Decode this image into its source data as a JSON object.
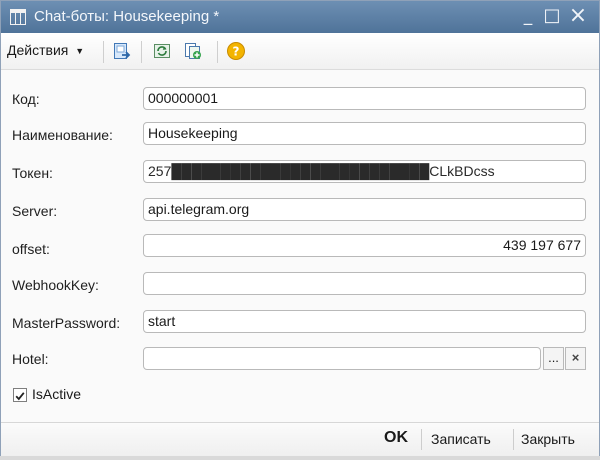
{
  "window": {
    "title": "Chat-боты: Housekeeping *",
    "minimize_symbol": "_",
    "maximize_symbol": "□",
    "close_symbol": "×"
  },
  "toolbar": {
    "actions_label": "Действия",
    "icons": [
      "save-and-close-icon",
      "refresh-icon",
      "copy-icon",
      "help-icon"
    ]
  },
  "form": {
    "code_label": "Код:",
    "code_value": "000000001",
    "name_label": "Наименование:",
    "name_value": "Housekeeping",
    "token_label": "Токен:",
    "token_value": "257██████████████████████████CLkBDcss",
    "server_label": "Server:",
    "server_value": "api.telegram.org",
    "offset_label": "offset:",
    "offset_value": "439 197 677",
    "webhook_label": "WebhookKey:",
    "webhook_value": "",
    "master_label": "MasterPassword:",
    "master_value": "start",
    "hotel_label": "Hotel:",
    "hotel_value": "",
    "hotel_select_symbol": "...",
    "hotel_clear_symbol": "×",
    "isactive_label": "IsActive",
    "isactive_checked": true
  },
  "footer": {
    "ok_label": "OK",
    "save_label": "Записать",
    "close_label": "Закрыть"
  },
  "colors": {
    "titlebar": "#5b7fa6",
    "help_icon": "#f3b400"
  }
}
